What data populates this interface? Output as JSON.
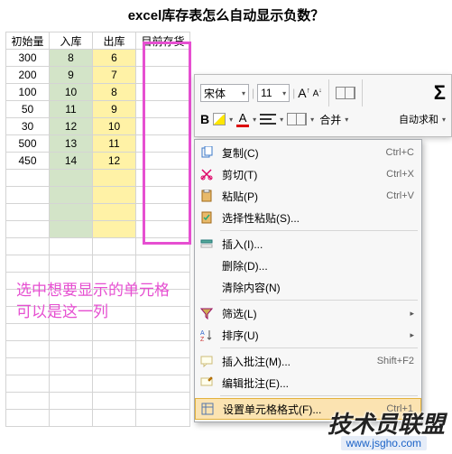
{
  "title": "excel库存表怎么自动显示负数？",
  "headers": [
    "初始量",
    "入库",
    "出库",
    "目前存货"
  ],
  "rows": [
    {
      "a": "300",
      "b": "8",
      "c": "6"
    },
    {
      "a": "200",
      "b": "9",
      "c": "7"
    },
    {
      "a": "100",
      "b": "10",
      "c": "8"
    },
    {
      "a": "50",
      "b": "11",
      "c": "9"
    },
    {
      "a": "30",
      "b": "12",
      "c": "10"
    },
    {
      "a": "500",
      "b": "13",
      "c": "11"
    },
    {
      "a": "450",
      "b": "14",
      "c": "12"
    }
  ],
  "annot": {
    "l1": "选中想要显示的单元格",
    "l2": "可以是这一列"
  },
  "toolbar": {
    "font": "宋体",
    "size": "11",
    "bold": "B",
    "merge_lbl": "合并",
    "sum_lbl": "自动求和"
  },
  "menu": {
    "copy": {
      "t": "复制(C)",
      "s": "Ctrl+C"
    },
    "cut": {
      "t": "剪切(T)",
      "s": "Ctrl+X"
    },
    "paste": {
      "t": "粘贴(P)",
      "s": "Ctrl+V"
    },
    "paste_sp": {
      "t": "选择性粘贴(S)..."
    },
    "insert": {
      "t": "插入(I)..."
    },
    "delete": {
      "t": "删除(D)..."
    },
    "clear": {
      "t": "清除内容(N)"
    },
    "filter": {
      "t": "筛选(L)"
    },
    "sort": {
      "t": "排序(U)"
    },
    "ins_cmt": {
      "t": "插入批注(M)...",
      "s": "Shift+F2"
    },
    "edit_cmt": {
      "t": "编辑批注(E)..."
    },
    "format": {
      "t": "设置单元格格式(F)...",
      "s": "Ctrl+1"
    }
  },
  "wm": {
    "big": "技术员联盟",
    "url": "www.jsgho.com"
  }
}
